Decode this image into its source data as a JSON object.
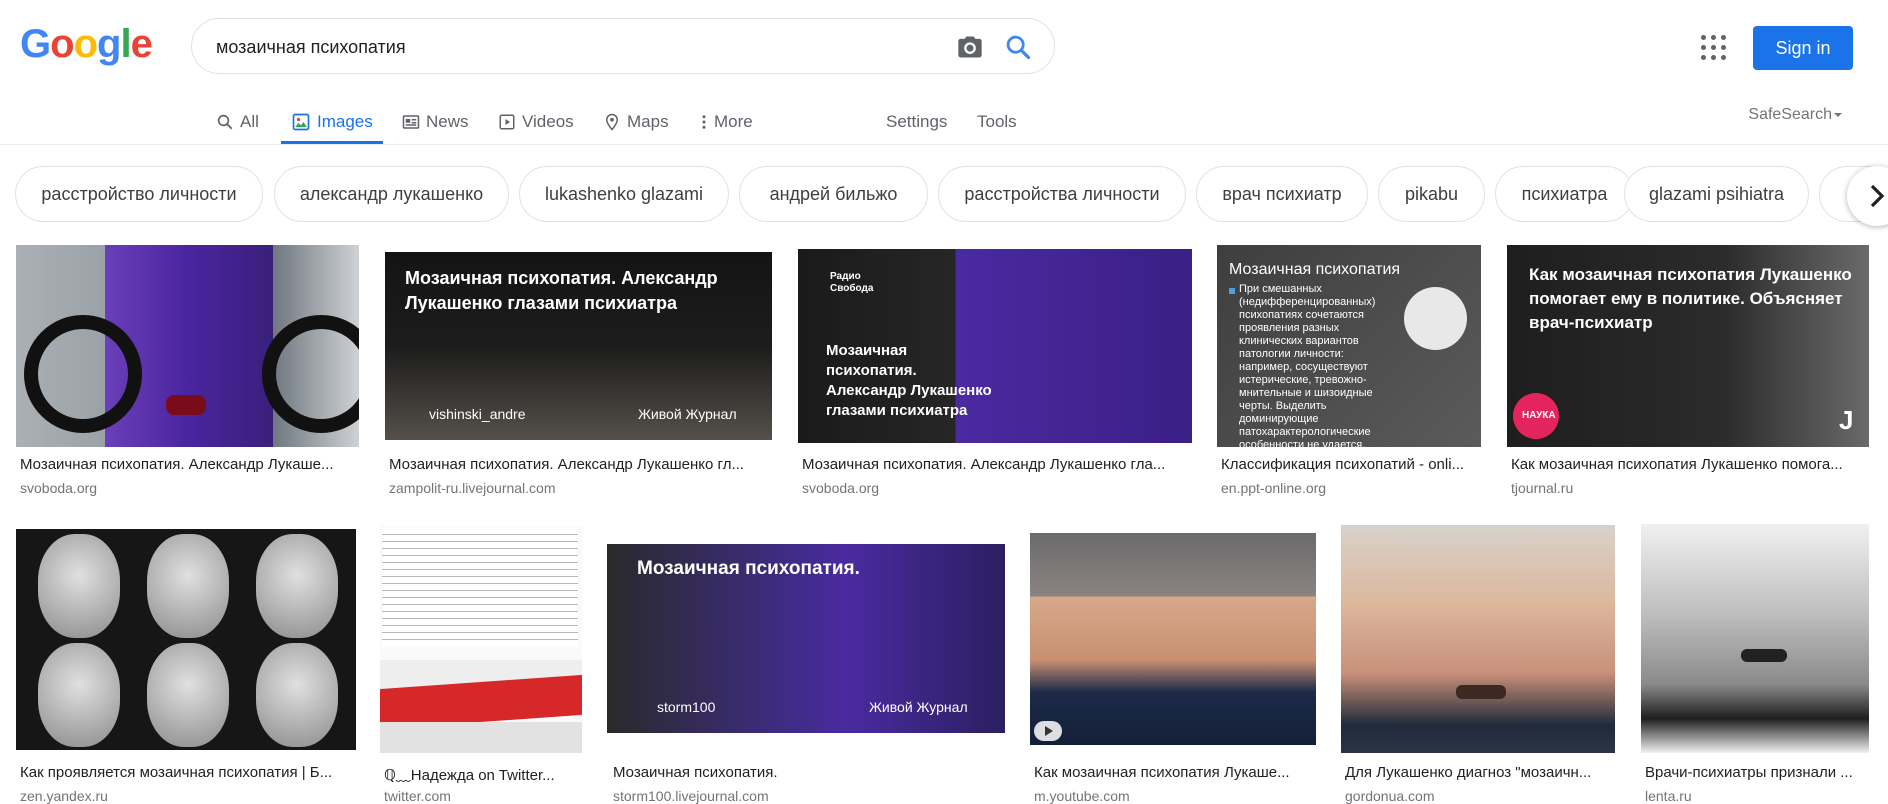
{
  "logo": {
    "letters": [
      "G",
      "o",
      "o",
      "g",
      "l",
      "e"
    ],
    "colors": [
      "#4285f4",
      "#ea4335",
      "#fbbc05",
      "#4285f4",
      "#34a853",
      "#ea4335"
    ]
  },
  "search": {
    "query": "мозаичная психопатия"
  },
  "header": {
    "signin_label": "Sign in"
  },
  "tabs": [
    {
      "label": "All",
      "icon": "search-icon"
    },
    {
      "label": "Images",
      "icon": "image-icon",
      "active": true
    },
    {
      "label": "News",
      "icon": "news-icon"
    },
    {
      "label": "Videos",
      "icon": "video-icon"
    },
    {
      "label": "Maps",
      "icon": "map-pin-icon"
    },
    {
      "label": "More",
      "icon": "more-vert-icon"
    },
    {
      "label": "Settings"
    },
    {
      "label": "Tools"
    }
  ],
  "safesearch": "SafeSearch",
  "chips": [
    "расстройство личности",
    "александр лукашенко",
    "lukashenko glazami",
    "андрей бильжо",
    "расстройства личности",
    "врач психиатр",
    "pikabu",
    "психиатра",
    "glazami psihiatra"
  ],
  "results": [
    {
      "title": "Мозаичная психопатия. Александр Лукаше...",
      "source": "svoboda.org"
    },
    {
      "title": "Мозаичная психопатия. Александр Лукашенко гл...",
      "source": "zampolit-ru.livejournal.com",
      "overlay": "Мозаичная психопатия. Александр Лукашенко глазами психиатра",
      "user": "vishinski_andre",
      "badge": "Живой Журнал"
    },
    {
      "title": "Мозаичная психопатия. Александр Лукашенко гла...",
      "source": "svoboda.org",
      "overlay": "Мозаичная психопатия. Александр Лукашенко глазами психиатра",
      "brand": "Радио Свобода"
    },
    {
      "title": "Классификация психопатий - onli...",
      "source": "en.ppt-online.org",
      "overlay": "Мозаичная психопатия",
      "body": "При смешанных (недифференцированных) психопатиях сочетаются проявления разных клинических вариантов патологии личности: например, сосуществуют истерические, тревожно-мнительные и шизоидные черты. Выделить доминирующие патохарактерологические особенности не удается."
    },
    {
      "title": "Как мозаичная психопатия Лукашенко помога...",
      "source": "tjournal.ru",
      "overlay": "Как мозаичная психопатия Лукашенко помогает ему в политике. Объясняет врач-психиатр",
      "badge": "НАУКА"
    },
    {
      "title": "Как проявляется мозаичная психопатия | Б...",
      "source": "zen.yandex.ru"
    },
    {
      "title": "ℚ﹏Надежда on Twitter...",
      "source": "twitter.com"
    },
    {
      "title": "Мозаичная психопатия.",
      "source": "storm100.livejournal.com",
      "overlay": "Мозаичная психопатия.",
      "user": "storm100",
      "badge": "Живой Журнал"
    },
    {
      "title": "Как мозаичная психопатия Лукаше...",
      "source": "m.youtube.com"
    },
    {
      "title": "Для Лукашенко диагноз \"мозаичн...",
      "source": "gordonua.com"
    },
    {
      "title": "Врачи-психиатры признали ...",
      "source": "lenta.ru"
    }
  ]
}
